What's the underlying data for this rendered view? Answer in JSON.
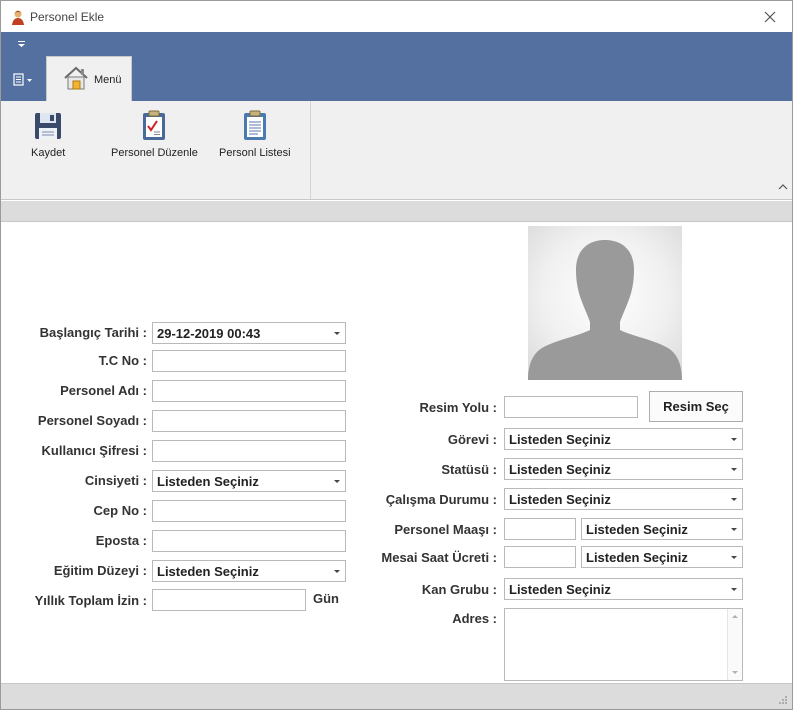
{
  "window": {
    "title": "Personel Ekle"
  },
  "ribbon": {
    "tab_label": "Menü",
    "buttons": {
      "save": "Kaydet",
      "edit": "Personel Düzenle",
      "list": "Personl Listesi"
    }
  },
  "form": {
    "labels": {
      "start_date": "Başlangıç Tarihi :",
      "tc_no": "T.C No :",
      "first_name": "Personel Adı :",
      "last_name": "Personel Soyadı :",
      "password": "Kullanıcı Şifresi :",
      "gender": "Cinsiyeti :",
      "phone": "Cep No :",
      "email": "Eposta :",
      "education": "Eğitim Düzeyi :",
      "annual_leave": "Yıllık Toplam İzin :",
      "annual_leave_unit": "Gün",
      "image_path": "Resim Yolu :",
      "position": "Görevi :",
      "status": "Statüsü :",
      "work_status": "Çalışma Durumu :",
      "salary": "Personel Maaşı :",
      "overtime_fee": "Mesai Saat Ücreti :",
      "blood_group": "Kan Grubu :",
      "address": "Adres :"
    },
    "values": {
      "start_date": "29-12-2019 00:43",
      "tc_no": "",
      "first_name": "",
      "last_name": "",
      "password": "",
      "gender": "Listeden Seçiniz",
      "phone": "",
      "email": "",
      "education": "Listeden Seçiniz",
      "annual_leave": "",
      "image_path": "",
      "position": "Listeden Seçiniz",
      "status": "Listeden Seçiniz",
      "work_status": "Listeden Seçiniz",
      "salary": "",
      "salary_currency": "Listeden Seçiniz",
      "overtime_fee": "",
      "overtime_currency": "Listeden Seçiniz",
      "blood_group": "Listeden Seçiniz",
      "address": ""
    },
    "select_image_button": "Resim Seç"
  },
  "colors": {
    "ribbon_header": "#5470a0",
    "ribbon_body": "#f0f0f0",
    "photo_silhouette": "#9a9a9a"
  }
}
